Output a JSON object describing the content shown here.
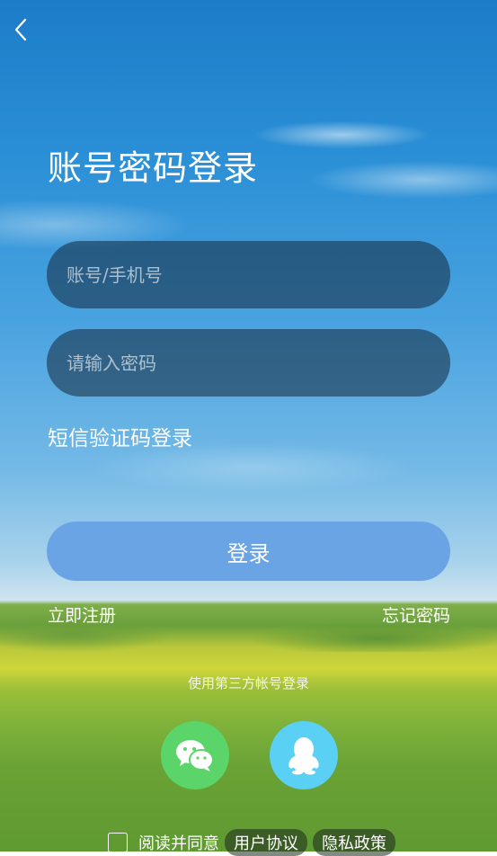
{
  "header": {
    "back_icon": "chevron-left-icon"
  },
  "title": "账号密码登录",
  "fields": {
    "account_placeholder": "账号/手机号",
    "password_placeholder": "请输入密码"
  },
  "sms_login_label": "短信验证码登录",
  "login_button_label": "登录",
  "register_label": "立即注册",
  "forgot_label": "忘记密码",
  "third_party_label": "使用第三方帐号登录",
  "social": [
    {
      "name": "wechat",
      "icon": "wechat-icon",
      "color": "#5bd46a"
    },
    {
      "name": "qq",
      "icon": "qq-icon",
      "color": "#5ad0f4"
    }
  ],
  "agreement": {
    "prefix": "阅读并同意",
    "user_agreement": "用户协议",
    "privacy_policy": "隐私政策"
  },
  "colors": {
    "accent_button": "#6aa4e4"
  }
}
